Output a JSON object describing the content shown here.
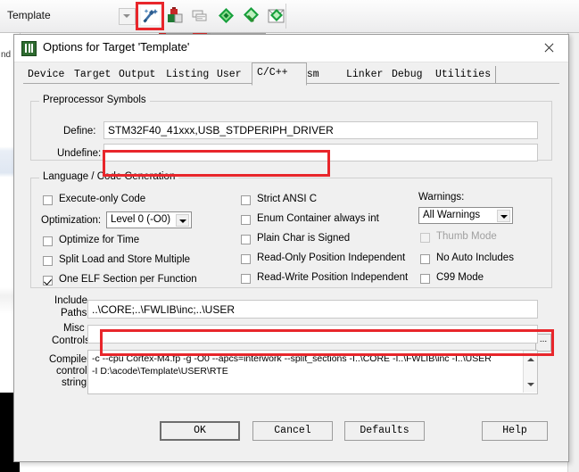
{
  "ide": {
    "target_label": "Template",
    "icons": [
      {
        "name": "target-options-wand-icon"
      },
      {
        "name": "build-icon"
      },
      {
        "name": "batch-build-icon"
      },
      {
        "name": "manage-components-icon"
      },
      {
        "name": "manage-project-items-icon"
      },
      {
        "name": "pack-installer-icon"
      }
    ]
  },
  "dialog": {
    "title": "Options for Target 'Template'",
    "close_label": "",
    "tabs": [
      {
        "label": "Device",
        "active": false
      },
      {
        "label": "Target",
        "active": false
      },
      {
        "label": "Output",
        "active": false
      },
      {
        "label": "Listing",
        "active": false
      },
      {
        "label": "User",
        "active": false
      },
      {
        "label": "C/C++",
        "active": true
      },
      {
        "label": "Asm",
        "active": false
      },
      {
        "label": "Linker",
        "active": false
      },
      {
        "label": "Debug",
        "active": false
      },
      {
        "label": "Utilities",
        "active": false
      }
    ],
    "preprocessor": {
      "group_label": "Preprocessor Symbols",
      "define_label": "Define:",
      "define_value": "STM32F40_41xxx,USB_STDPERIPH_DRIVER",
      "undefine_label": "Undefine:",
      "undefine_value": ""
    },
    "language": {
      "group_label": "Language / Code Generation",
      "left_checks": [
        {
          "label": "Execute-only Code",
          "checked": false,
          "disabled": false
        },
        {
          "label": "Optimize for Time",
          "checked": false,
          "disabled": false
        },
        {
          "label": "Split Load and Store Multiple",
          "checked": false,
          "disabled": false
        },
        {
          "label": "One ELF Section per Function",
          "checked": true,
          "disabled": false
        }
      ],
      "optimization_label": "Optimization:",
      "optimization_value": "Level 0 (-O0)",
      "middle_checks": [
        {
          "label": "Strict ANSI C",
          "checked": false,
          "disabled": false
        },
        {
          "label": "Enum Container always int",
          "checked": false,
          "disabled": false
        },
        {
          "label": "Plain Char is Signed",
          "checked": false,
          "disabled": false
        },
        {
          "label": "Read-Only Position Independent",
          "checked": false,
          "disabled": false
        },
        {
          "label": "Read-Write Position Independent",
          "checked": false,
          "disabled": false
        }
      ],
      "warnings_label": "Warnings:",
      "warnings_value": "All Warnings",
      "right_checks": [
        {
          "label": "Thumb Mode",
          "checked": false,
          "disabled": true
        },
        {
          "label": "No Auto Includes",
          "checked": false,
          "disabled": false
        },
        {
          "label": "C99 Mode",
          "checked": false,
          "disabled": false
        }
      ]
    },
    "include": {
      "label_line1": "Include",
      "label_line2": "Paths",
      "value": "..\\CORE;..\\FWLIB\\inc;..\\USER",
      "browse_label": "..."
    },
    "misc": {
      "label_line1": "Misc",
      "label_line2": "Controls",
      "value": ""
    },
    "compiler": {
      "label_line1": "Compiler",
      "label_line2": "control",
      "label_line3": "string",
      "line1": "-c --cpu Cortex-M4.fp -g -O0 --apcs=interwork --split_sections -I..\\CORE -I..\\FWLIB\\inc -I..\\USER",
      "line2": "-I D:\\acode\\Template\\USER\\RTE"
    },
    "buttons": {
      "ok": "OK",
      "cancel": "Cancel",
      "defaults": "Defaults",
      "help": "Help"
    }
  },
  "annotations": {
    "accent_color": "#e8262b",
    "boxes": [
      "toolbar-target-options",
      "define-field",
      "include-paths-field"
    ]
  }
}
